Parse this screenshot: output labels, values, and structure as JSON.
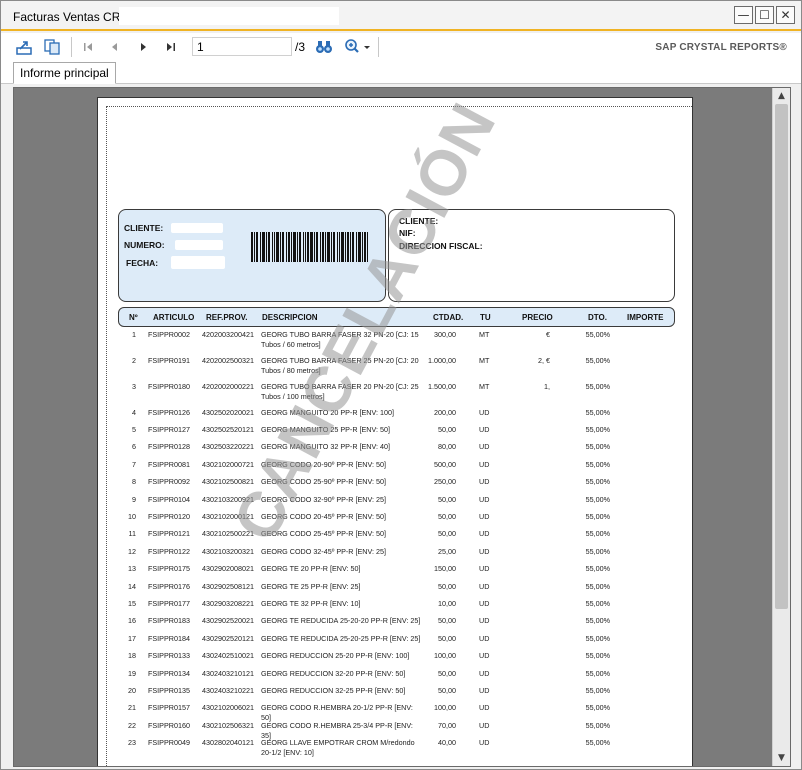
{
  "window": {
    "title": "Facturas Ventas CR",
    "controls": {
      "minimize": "—",
      "maximize": "☐",
      "close": "✕"
    }
  },
  "toolbar": {
    "current_page": "1",
    "total_pages": "/3",
    "brand": "SAP CRYSTAL REPORTS®"
  },
  "tabs": [
    {
      "label": "Informe principal"
    }
  ],
  "report": {
    "left_box": {
      "cliente": "CLIENTE:",
      "numero": "NUMERO:",
      "fecha": "FECHA:"
    },
    "right_box": {
      "cliente": "CLIENTE:",
      "nif": "NIF:",
      "direccion": "DIRECCION FISCAL:"
    },
    "headers": {
      "num": "Nº",
      "articulo": "ARTICULO",
      "refprov": "REF.PROV.",
      "descripcion": "DESCRIPCION",
      "ctdad": "CTDAD.",
      "tu": "TU",
      "precio": "PRECIO",
      "dto": "DTO.",
      "importe": "IMPORTE"
    },
    "watermark": "CANCELACIÓN",
    "rows": [
      {
        "n": "1",
        "art": "FSIPPR0002",
        "ref": "4202003200421",
        "desc": "GEORG TUBO BARRA FASER 32 PN-20  [CJ: 15 Tubos / 60 metros]",
        "qty": "300,00",
        "tu": "MT",
        "precio": "€",
        "dto": "55,00%"
      },
      {
        "n": "2",
        "art": "FSIPPR0191",
        "ref": "4202002500321",
        "desc": "GEORG TUBO BARRA FASER 25 PN-20  [CJ: 20 Tubos / 80 metros]",
        "qty": "1.000,00",
        "tu": "MT",
        "precio": "2,   €",
        "dto": "55,00%"
      },
      {
        "n": "3",
        "art": "FSIPPR0180",
        "ref": "4202002000221",
        "desc": "GEORG TUBO BARRA FASER 20 PN-20  [CJ: 25 Tubos / 100 metros]",
        "qty": "1.500,00",
        "tu": "MT",
        "precio": "1,",
        "dto": "55,00%"
      },
      {
        "n": "4",
        "art": "FSIPPR0126",
        "ref": "4302502020021",
        "desc": "GEORG MANGUITO 20 PP-R  [ENV: 100]",
        "qty": "200,00",
        "tu": "UD",
        "precio": "",
        "dto": "55,00%"
      },
      {
        "n": "5",
        "art": "FSIPPR0127",
        "ref": "4302502520121",
        "desc": "GEORG MANGUITO 25 PP-R  [ENV: 50]",
        "qty": "50,00",
        "tu": "UD",
        "precio": "",
        "dto": "55,00%"
      },
      {
        "n": "6",
        "art": "FSIPPR0128",
        "ref": "4302503220221",
        "desc": "GEORG MANGUITO 32 PP-R  [ENV: 40]",
        "qty": "80,00",
        "tu": "UD",
        "precio": "",
        "dto": "55,00%"
      },
      {
        "n": "7",
        "art": "FSIPPR0081",
        "ref": "4302102000721",
        "desc": "GEORG CODO 20-90º PP-R  [ENV: 50]",
        "qty": "500,00",
        "tu": "UD",
        "precio": "",
        "dto": "55,00%"
      },
      {
        "n": "8",
        "art": "FSIPPR0092",
        "ref": "4302102500821",
        "desc": "GEORG CODO 25-90º PP-R  [ENV: 50]",
        "qty": "250,00",
        "tu": "UD",
        "precio": "",
        "dto": "55,00%"
      },
      {
        "n": "9",
        "art": "FSIPPR0104",
        "ref": "4302103200921",
        "desc": "GEORG CODO 32-90º PP-R  [ENV: 25]",
        "qty": "50,00",
        "tu": "UD",
        "precio": "",
        "dto": "55,00%"
      },
      {
        "n": "10",
        "art": "FSIPPR0120",
        "ref": "4302102000121",
        "desc": "GEORG CODO 20-45º PP-R  [ENV: 50]",
        "qty": "50,00",
        "tu": "UD",
        "precio": "",
        "dto": "55,00%"
      },
      {
        "n": "11",
        "art": "FSIPPR0121",
        "ref": "4302102500221",
        "desc": "GEORG CODO 25-45º PP-R  [ENV: 50]",
        "qty": "50,00",
        "tu": "UD",
        "precio": "",
        "dto": "55,00%"
      },
      {
        "n": "12",
        "art": "FSIPPR0122",
        "ref": "4302103200321",
        "desc": "GEORG CODO 32-45º PP-R  [ENV: 25]",
        "qty": "25,00",
        "tu": "UD",
        "precio": "",
        "dto": "55,00%"
      },
      {
        "n": "13",
        "art": "FSIPPR0175",
        "ref": "4302902008021",
        "desc": "GEORG TE 20 PP-R  [ENV: 50]",
        "qty": "150,00",
        "tu": "UD",
        "precio": "",
        "dto": "55,00%"
      },
      {
        "n": "14",
        "art": "FSIPPR0176",
        "ref": "4302902508121",
        "desc": "GEORG TE 25 PP-R  [ENV: 25]",
        "qty": "50,00",
        "tu": "UD",
        "precio": "",
        "dto": "55,00%"
      },
      {
        "n": "15",
        "art": "FSIPPR0177",
        "ref": "4302903208221",
        "desc": "GEORG TE 32 PP-R  [ENV: 10]",
        "qty": "10,00",
        "tu": "UD",
        "precio": "",
        "dto": "55,00%"
      },
      {
        "n": "16",
        "art": "FSIPPR0183",
        "ref": "4302902520021",
        "desc": "GEORG TE REDUCIDA 25-20-20 PP-R  [ENV: 25]",
        "qty": "50,00",
        "tu": "UD",
        "precio": "",
        "dto": "55,00%"
      },
      {
        "n": "17",
        "art": "FSIPPR0184",
        "ref": "4302902520121",
        "desc": "GEORG TE REDUCIDA 25-20-25 PP-R  [ENV: 25]",
        "qty": "50,00",
        "tu": "UD",
        "precio": "",
        "dto": "55,00%"
      },
      {
        "n": "18",
        "art": "FSIPPR0133",
        "ref": "4302402510021",
        "desc": "GEORG REDUCCION 25-20 PP-R  [ENV: 100]",
        "qty": "100,00",
        "tu": "UD",
        "precio": "",
        "dto": "55,00%"
      },
      {
        "n": "19",
        "art": "FSIPPR0134",
        "ref": "4302403210121",
        "desc": "GEORG REDUCCION 32-20 PP-R  [ENV: 50]",
        "qty": "50,00",
        "tu": "UD",
        "precio": "",
        "dto": "55,00%"
      },
      {
        "n": "20",
        "art": "FSIPPR0135",
        "ref": "4302403210221",
        "desc": "GEORG REDUCCION 32-25 PP-R  [ENV: 50]",
        "qty": "50,00",
        "tu": "UD",
        "precio": "",
        "dto": "55,00%"
      },
      {
        "n": "21",
        "art": "FSIPPR0157",
        "ref": "4302102006021",
        "desc": "GEORG CODO R.HEMBRA 20-1/2 PP-R  [ENV: 50]",
        "qty": "100,00",
        "tu": "UD",
        "precio": "",
        "dto": "55,00%"
      },
      {
        "n": "22",
        "art": "FSIPPR0160",
        "ref": "4302102506321",
        "desc": "GEORG CODO R.HEMBRA 25-3/4 PP-R  [ENV: 35]",
        "qty": "70,00",
        "tu": "UD",
        "precio": "",
        "dto": "55,00%"
      },
      {
        "n": "23",
        "art": "FSIPPR0049",
        "ref": "4302802040121",
        "desc": "GEORG LLAVE EMPOTRAR CROM M/redondo 20-1/2 [ENV: 10]",
        "qty": "40,00",
        "tu": "UD",
        "precio": "",
        "dto": "55,00%"
      }
    ]
  }
}
